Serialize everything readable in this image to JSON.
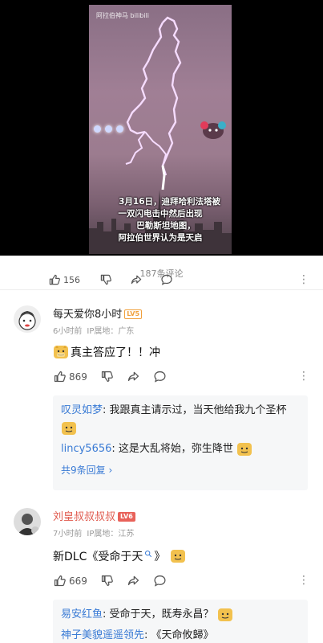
{
  "video": {
    "watermark": "阿拉伯神马 bilibili",
    "caption_lines": [
      "3月16日，迪拜哈利法塔被",
      "一双闪电击中然后出现",
      "巴勒斯坦地图，",
      "阿拉伯世界认为是天启"
    ]
  },
  "comments_header": {
    "count_label": "187条评论",
    "partial_like_count": "156"
  },
  "comments": [
    {
      "username": "每天爱你8小时",
      "level": "LV5",
      "level_color": "#f0a03c",
      "time": "6小时前",
      "ip": "IP属地：广东",
      "text_before": "真主答应了！！冲",
      "text_after": "",
      "like_count": "869",
      "replies": [
        {
          "name": "叹灵如梦",
          "text": "我跟真主请示过，当天他给我九个圣杯"
        },
        {
          "name": "lincy5656",
          "text": "这是大乱将始，弥生降世"
        }
      ],
      "reply_more": "共9条回复 ›"
    },
    {
      "username": "刘皇叔叔叔叔",
      "level": "LV6",
      "level_color": "#e8625a",
      "time": "7小时前",
      "ip": "IP属地：江苏",
      "text_before": "新DLC《受命于天",
      "text_after": "》",
      "like_count": "669",
      "replies": [
        {
          "name": "易安红鱼",
          "text": "受命于天，既寿永昌？"
        },
        {
          "name": "神子美貌遥遥领先",
          "text": "《天命攸歸》"
        }
      ]
    }
  ],
  "colors": {
    "username_red": "#e05a4e",
    "username_dark": "#222222",
    "reply_name": "#3a7bd5"
  },
  "icons": [
    "thumb-up-icon",
    "thumb-down-icon",
    "share-icon",
    "comment-icon",
    "more-icon",
    "doge-emoji-icon",
    "search-icon"
  ]
}
